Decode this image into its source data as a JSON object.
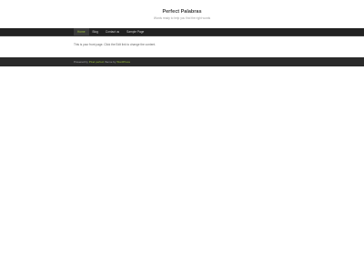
{
  "site": {
    "title": "Perfect Palabras",
    "description": "Words ready to help you find the right words"
  },
  "nav": {
    "items": [
      {
        "label": "Home",
        "active": true
      },
      {
        "label": "Blog",
        "active": false
      },
      {
        "label": "Contact us",
        "active": false
      },
      {
        "label": "Sample Page",
        "active": false
      }
    ]
  },
  "main": {
    "text": "This is your front page. Click the Edit link to change the content."
  },
  "footer": {
    "prefix": "Powered by ",
    "link1": "Pixel perfect",
    "middle": " theme by ",
    "link2": "WordPress"
  },
  "colors": {
    "nav_bg": "#222222",
    "accent": "#9ec23d",
    "footer_bg": "#2a2a2a"
  }
}
